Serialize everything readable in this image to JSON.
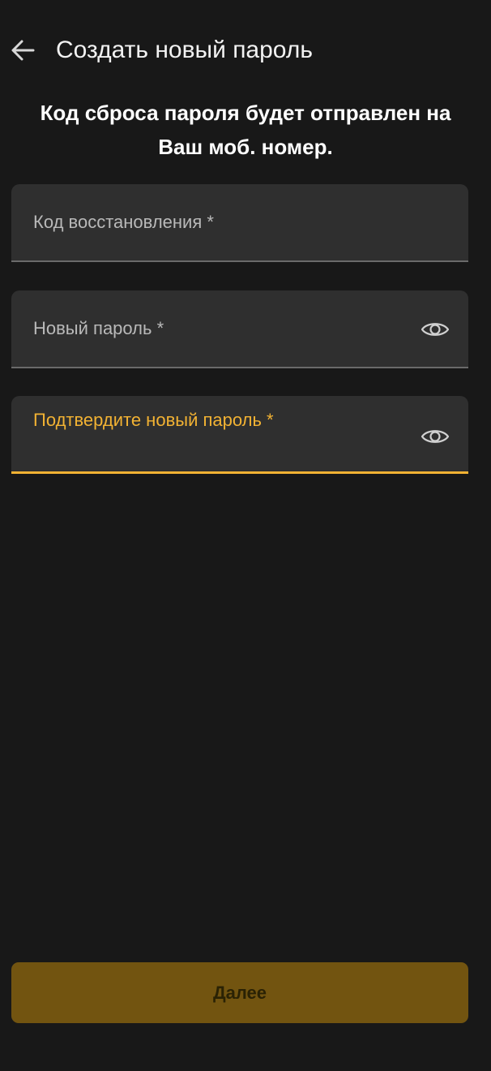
{
  "header": {
    "back_icon": "arrow-left-icon",
    "title": "Создать новый пароль"
  },
  "info": {
    "text": "Код сброса пароля будет отправлен на Ваш моб. номер."
  },
  "fields": {
    "recovery_code": {
      "label": "Код восстановления *",
      "value": ""
    },
    "new_password": {
      "label": "Новый пароль *",
      "value": "",
      "toggle_icon": "eye-icon"
    },
    "confirm_password": {
      "label": "Подтвердите новый пароль *",
      "value": "",
      "toggle_icon": "eye-icon",
      "focused": true
    }
  },
  "actions": {
    "next_label": "Далее"
  },
  "colors": {
    "background": "#181818",
    "field_background": "#2f2f2f",
    "accent": "#f2b233",
    "button_disabled": "#725410"
  }
}
